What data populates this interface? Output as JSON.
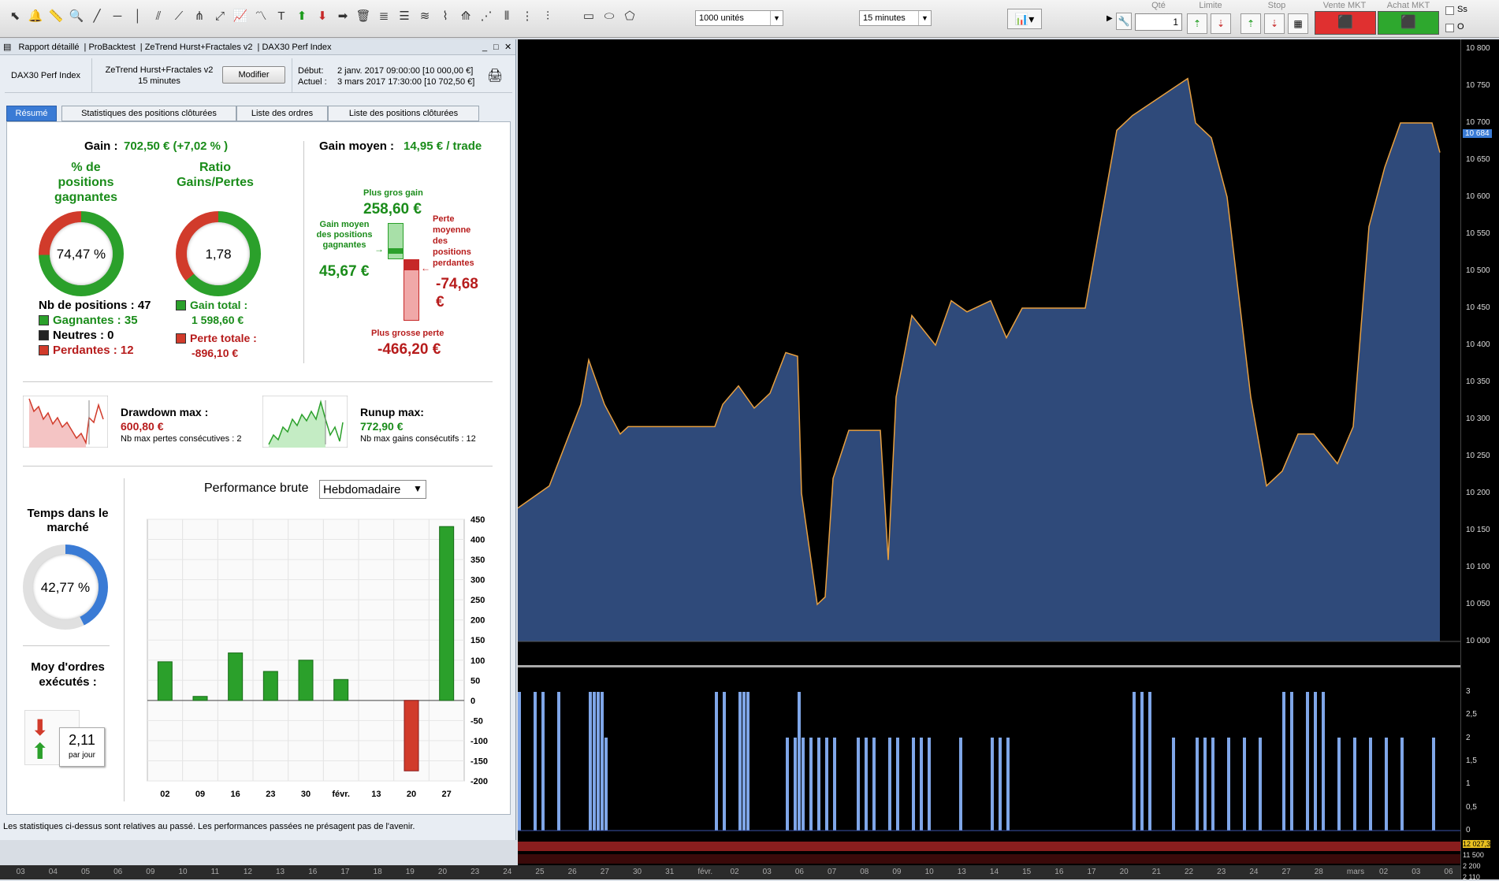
{
  "toolbar": {
    "units_select": "1000 unités",
    "timeframe_select": "15 minutes",
    "qty_label": "Qté",
    "qty_value": "1",
    "limit_label": "Limite",
    "stop_label": "Stop",
    "sell_label": "Vente MKT",
    "buy_label": "Achat MKT",
    "ss_label": "Ss",
    "o_label": "O",
    "sell_color": "#e03030",
    "buy_color": "#2ea82e"
  },
  "panel": {
    "header_items": [
      "Rapport détaillé",
      "ProBacktest",
      "ZeTrend Hurst+Fractales v2",
      "DAX30 Perf Index"
    ],
    "instrument": "DAX30 Perf Index",
    "strategy_name": "ZeTrend Hurst+Fractales v2",
    "strategy_tf": "15 minutes",
    "modify_btn": "Modifier",
    "debut_label": "Début:",
    "debut_value": "2 janv. 2017 09:00:00 [10 000,00 €]",
    "actuel_label": "Actuel :",
    "actuel_value": "3 mars 2017 17:30:00 [10 702,50 €]",
    "tabs": [
      "Résumé",
      "Statistiques des positions clôturées",
      "Liste des ordres",
      "Liste des positions clôturées"
    ],
    "gain_label": "Gain :",
    "gain_value": "702,50 € (+7,02 % )",
    "gain_moyen_label": "Gain moyen :",
    "gain_moyen_value": "14,95 € / trade",
    "pct_title": "% de positions gagnantes",
    "pct_value": "74,47 %",
    "pct_fraction": 0.7447,
    "ratio_title": "Ratio Gains/Pertes",
    "ratio_value": "1,78",
    "nb_positions": "Nb de positions : 47",
    "gagnantes": "Gagnantes : 35",
    "neutres": "Neutres : 0",
    "perdantes": "Perdantes : 12",
    "gain_total_label": "Gain total :",
    "gain_total_value": "1 598,60 €",
    "perte_totale_label": "Perte totale :",
    "perte_totale_value": "-896,10 €",
    "plus_gros_gain_label": "Plus gros gain",
    "plus_gros_gain_value": "258,60 €",
    "gain_moyen_pos_label": "Gain moyen des positions gagnantes",
    "gain_moyen_pos_value": "45,67 €",
    "perte_moyenne_label": "Perte moyenne des positions perdantes",
    "perte_moyenne_value": "-74,68 €",
    "plus_grosse_perte_label": "Plus grosse perte",
    "plus_grosse_perte_value": "-466,20 €",
    "drawdown_label": "Drawdown max :",
    "drawdown_value": "600,80 €",
    "drawdown_sub": "Nb max pertes consécutives : 2",
    "runup_label": "Runup max:",
    "runup_value": "772,90 €",
    "runup_sub": "Nb max gains consécutifs : 12",
    "temps_label": "Temps dans le marché",
    "temps_value": "42,77 %",
    "temps_fraction": 0.4277,
    "moy_label": "Moy d'ordres exécutés :",
    "moy_value": "2,11",
    "moy_unit": "par jour",
    "perf_label": "Performance brute",
    "perf_select": "Hebdomadaire",
    "footer": "Les statistiques ci-dessus sont relatives au passé. Les performances passées ne présagent pas de l'avenir."
  },
  "chart_data": [
    {
      "type": "bar",
      "title": "Performance brute",
      "categories": [
        "02",
        "09",
        "16",
        "23",
        "30",
        "févr.",
        "13",
        "20",
        "27"
      ],
      "values": [
        96,
        10,
        118,
        72,
        100,
        52,
        0,
        -175,
        432
      ],
      "ylim": [
        -200,
        450
      ],
      "yticks": [
        450,
        400,
        350,
        300,
        250,
        200,
        150,
        100,
        50,
        0,
        -50,
        -100,
        -150,
        -200
      ]
    }
  ],
  "main_chart": {
    "price_labels": [
      "10 800",
      "10 750",
      "10 700",
      "10 650",
      "10 600",
      "10 550",
      "10 500",
      "10 450",
      "10 400",
      "10 350",
      "10 300",
      "10 250",
      "10 200",
      "10 150",
      "10 100",
      "10 050",
      "10 000"
    ],
    "current_price": "10 684",
    "indicator_labels": [
      "3",
      "2,5",
      "2",
      "1,5",
      "1",
      "0,5",
      "0"
    ],
    "indicator_current": "2",
    "bottom_labels_right": [
      "12 027,3",
      "11 500",
      "2 200",
      "2 110"
    ],
    "date_labels": [
      "03",
      "04",
      "05",
      "06",
      "09",
      "10",
      "11",
      "12",
      "13",
      "16",
      "17",
      "18",
      "19",
      "20",
      "23",
      "24",
      "25",
      "26",
      "27",
      "30",
      "31",
      "févr.",
      "02",
      "03",
      "06",
      "07",
      "08",
      "09",
      "10",
      "13",
      "14",
      "15",
      "16",
      "17",
      "20",
      "21",
      "22",
      "23",
      "24",
      "27",
      "28",
      "mars",
      "02",
      "03",
      "06"
    ]
  }
}
